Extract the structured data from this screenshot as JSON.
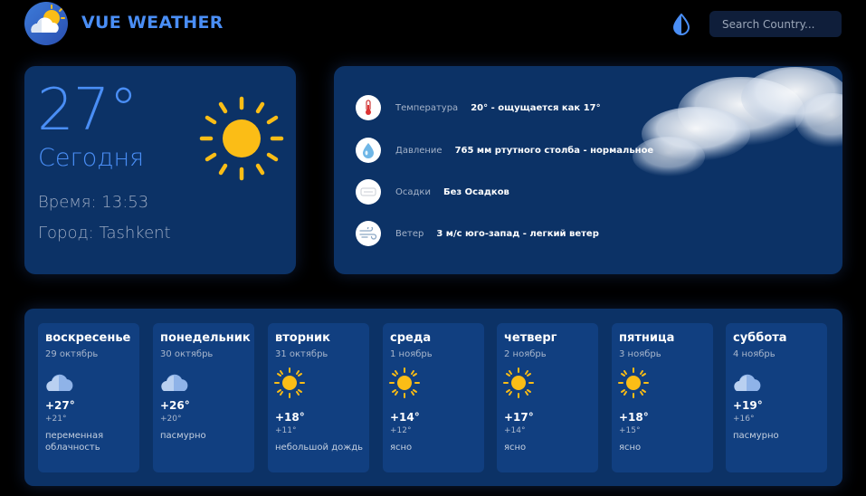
{
  "app": {
    "title": "VUE WEATHER",
    "search_placeholder": "Search Country..."
  },
  "colors": {
    "accent": "#4a8ef5",
    "card": "#0c3266",
    "day_card": "#113f80",
    "sun": "#fbbd16"
  },
  "current": {
    "temperature": "27°",
    "day": "Сегодня",
    "time": "Время: 13:53",
    "city": "Город: Tashkent",
    "icon": "sun-icon"
  },
  "details": [
    {
      "icon": "thermometer-icon",
      "label": "Температура",
      "value": "20° - ощущается как 17°"
    },
    {
      "icon": "droplet-icon",
      "label": "Давление",
      "value": "765 мм ртутного столба - нормальное"
    },
    {
      "icon": "precipitation-icon",
      "label": "Осадки",
      "value": "Без Осадков"
    },
    {
      "icon": "wind-icon",
      "label": "Ветер",
      "value": "3 м/с юго-запад - легкий ветер"
    }
  ],
  "week": [
    {
      "name": "воскресенье",
      "date": "29 октябрь",
      "icon": "cloud-icon",
      "max": "+27°",
      "min": "+21°",
      "desc": "переменная облачность"
    },
    {
      "name": "понедельник",
      "date": "30 октябрь",
      "icon": "cloud-icon",
      "max": "+26°",
      "min": "+20°",
      "desc": "пасмурно"
    },
    {
      "name": "вторник",
      "date": "31 октябрь",
      "icon": "sun-icon",
      "max": "+18°",
      "min": "+11°",
      "desc": "небольшой дождь"
    },
    {
      "name": "среда",
      "date": "1 ноябрь",
      "icon": "sun-icon",
      "max": "+14°",
      "min": "+12°",
      "desc": "ясно"
    },
    {
      "name": "четверг",
      "date": "2 ноябрь",
      "icon": "sun-icon",
      "max": "+17°",
      "min": "+14°",
      "desc": "ясно"
    },
    {
      "name": "пятница",
      "date": "3 ноябрь",
      "icon": "sun-icon",
      "max": "+18°",
      "min": "+15°",
      "desc": "ясно"
    },
    {
      "name": "суббота",
      "date": "4 ноябрь",
      "icon": "cloud-icon",
      "max": "+19°",
      "min": "+16°",
      "desc": "пасмурно"
    }
  ]
}
